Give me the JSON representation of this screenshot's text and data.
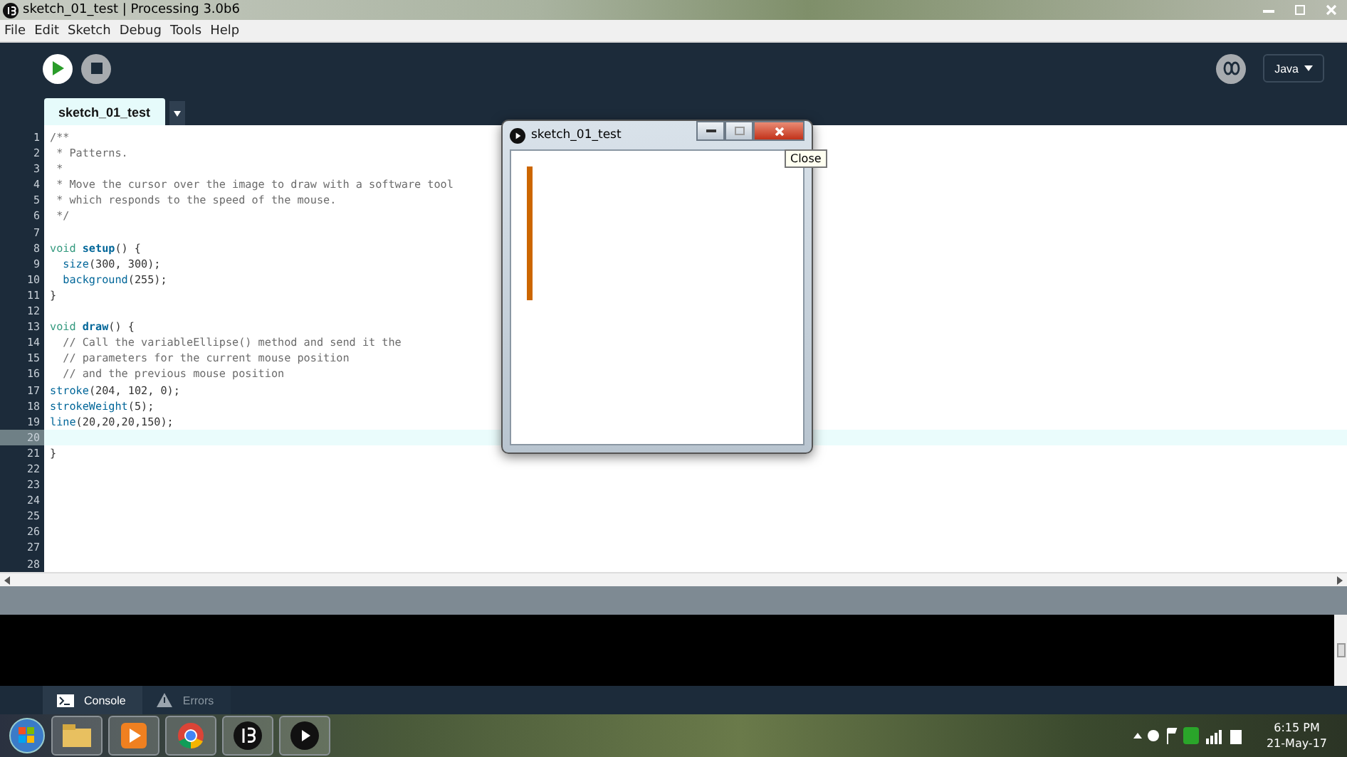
{
  "window": {
    "title": "sketch_01_test | Processing 3.0b6"
  },
  "menu": [
    "File",
    "Edit",
    "Sketch",
    "Debug",
    "Tools",
    "Help"
  ],
  "mode": {
    "label": "Java"
  },
  "tabs": [
    {
      "label": "sketch_01_test",
      "selected": true
    }
  ],
  "editor": {
    "lines": [
      {
        "number": "1",
        "current": false,
        "tokens": [
          {
            "kind": "comment",
            "text": "/**"
          }
        ]
      },
      {
        "number": "2",
        "current": false,
        "tokens": [
          {
            "kind": "comment",
            "text": " * Patterns."
          }
        ]
      },
      {
        "number": "3",
        "current": false,
        "tokens": [
          {
            "kind": "comment",
            "text": " *"
          }
        ]
      },
      {
        "number": "4",
        "current": false,
        "tokens": [
          {
            "kind": "comment",
            "text": " * Move the cursor over the image to draw with a software tool"
          }
        ]
      },
      {
        "number": "5",
        "current": false,
        "tokens": [
          {
            "kind": "comment",
            "text": " * which responds to the speed of the mouse."
          }
        ]
      },
      {
        "number": "6",
        "current": false,
        "tokens": [
          {
            "kind": "comment",
            "text": " */"
          }
        ]
      },
      {
        "number": "7",
        "current": false
      },
      {
        "number": "8",
        "current": false,
        "tokens": [
          {
            "kind": "keyword",
            "text": "void "
          },
          {
            "kind": "function",
            "text": "setup"
          },
          {
            "kind": "plain",
            "text": "() {"
          }
        ]
      },
      {
        "number": "9",
        "current": false,
        "tokens": [
          {
            "kind": "builtin",
            "text": "  size"
          },
          {
            "kind": "plain",
            "text": "(300, 300);"
          }
        ]
      },
      {
        "number": "10",
        "current": false,
        "tokens": [
          {
            "kind": "builtin",
            "text": "  background"
          },
          {
            "kind": "plain",
            "text": "(255);"
          }
        ]
      },
      {
        "number": "11",
        "current": false,
        "tokens": [
          {
            "kind": "plain",
            "text": "}"
          }
        ]
      },
      {
        "number": "12",
        "current": false
      },
      {
        "number": "13",
        "current": false,
        "tokens": [
          {
            "kind": "keyword",
            "text": "void "
          },
          {
            "kind": "function",
            "text": "draw"
          },
          {
            "kind": "plain",
            "text": "() {"
          }
        ]
      },
      {
        "number": "14",
        "current": false,
        "tokens": [
          {
            "kind": "comment",
            "text": "  // Call the variableEllipse() method and send it the"
          }
        ]
      },
      {
        "number": "15",
        "current": false,
        "tokens": [
          {
            "kind": "comment",
            "text": "  // parameters for the current mouse position"
          }
        ]
      },
      {
        "number": "16",
        "current": false,
        "tokens": [
          {
            "kind": "comment",
            "text": "  // and the previous mouse position"
          }
        ]
      },
      {
        "number": "17",
        "current": false,
        "tokens": [
          {
            "kind": "builtin",
            "text": "stroke"
          },
          {
            "kind": "plain",
            "text": "(204, 102, 0);"
          }
        ]
      },
      {
        "number": "18",
        "current": false,
        "tokens": [
          {
            "kind": "builtin",
            "text": "strokeWeight"
          },
          {
            "kind": "plain",
            "text": "(5);"
          }
        ]
      },
      {
        "number": "19",
        "current": false,
        "tokens": [
          {
            "kind": "builtin",
            "text": "line"
          },
          {
            "kind": "plain",
            "text": "(20,20,20,150);"
          }
        ]
      },
      {
        "number": "20",
        "current": true
      },
      {
        "number": "21",
        "current": false,
        "tokens": [
          {
            "kind": "plain",
            "text": "}"
          }
        ]
      },
      {
        "number": "22",
        "current": false
      },
      {
        "number": "23",
        "current": false
      },
      {
        "number": "24",
        "current": false
      },
      {
        "number": "25",
        "current": false
      },
      {
        "number": "26",
        "current": false
      },
      {
        "number": "27",
        "current": false
      },
      {
        "number": "28",
        "current": false
      }
    ]
  },
  "sketch_window": {
    "title": "sketch_01_test",
    "tooltip": "Close"
  },
  "console_tabs": [
    {
      "label": "Console",
      "selected": true
    },
    {
      "label": "Errors",
      "selected": false
    }
  ],
  "taskbar": {
    "time": "6:15 PM",
    "date": "21-May-17"
  }
}
